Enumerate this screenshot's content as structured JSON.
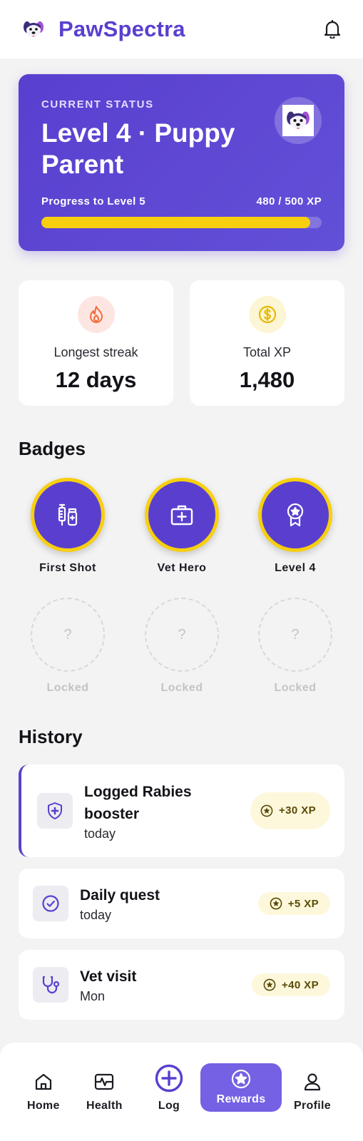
{
  "header": {
    "app_name": "PawSpectra",
    "logo_icon": "dog-face-icon",
    "notification_icon": "bell-icon"
  },
  "status": {
    "eyebrow": "CURRENT STATUS",
    "title": "Level 4 · Puppy Parent",
    "progress_label": "Progress to Level 5",
    "progress_value": "480 / 500 XP",
    "progress_fraction": 0.96
  },
  "stats": [
    {
      "label": "Longest streak",
      "value": "12 days",
      "icon": "flame-icon"
    },
    {
      "label": "Total XP",
      "value": "1,480",
      "icon": "coin-icon"
    }
  ],
  "badges": {
    "title": "Badges",
    "earned": [
      {
        "label": "First Shot",
        "icon": "syringe-vial-icon"
      },
      {
        "label": "Vet Hero",
        "icon": "medical-kit-icon"
      },
      {
        "label": "Level 4",
        "icon": "award-ribbon-icon"
      }
    ],
    "locked": [
      {
        "label": "Locked",
        "symbol": "?"
      },
      {
        "label": "Locked",
        "symbol": "?"
      },
      {
        "label": "Locked",
        "symbol": "?"
      }
    ]
  },
  "history": {
    "title": "History",
    "items": [
      {
        "title": "Logged Rabies booster",
        "sub": "today",
        "xp": "+30 XP",
        "icon": "shield-plus-icon"
      },
      {
        "title": "Daily quest",
        "sub": "today",
        "xp": "+5 XP",
        "icon": "check-circle-icon"
      },
      {
        "title": "Vet visit",
        "sub": "Mon",
        "xp": "+40 XP",
        "icon": "stethoscope-icon"
      }
    ]
  },
  "nav": {
    "items": [
      {
        "label": "Home",
        "icon": "home-icon"
      },
      {
        "label": "Health",
        "icon": "pulse-icon"
      },
      {
        "label": "Log",
        "icon": "plus-circle-icon"
      },
      {
        "label": "Rewards",
        "icon": "star-badge-icon",
        "active": true
      },
      {
        "label": "Profile",
        "icon": "user-icon"
      }
    ]
  },
  "colors": {
    "primary": "#5a3fcf",
    "accent_yellow": "#f7cf0f",
    "xp_pill_bg": "#fdf8dc",
    "nav_active": "#7461e4",
    "background": "#f3f3f3"
  }
}
